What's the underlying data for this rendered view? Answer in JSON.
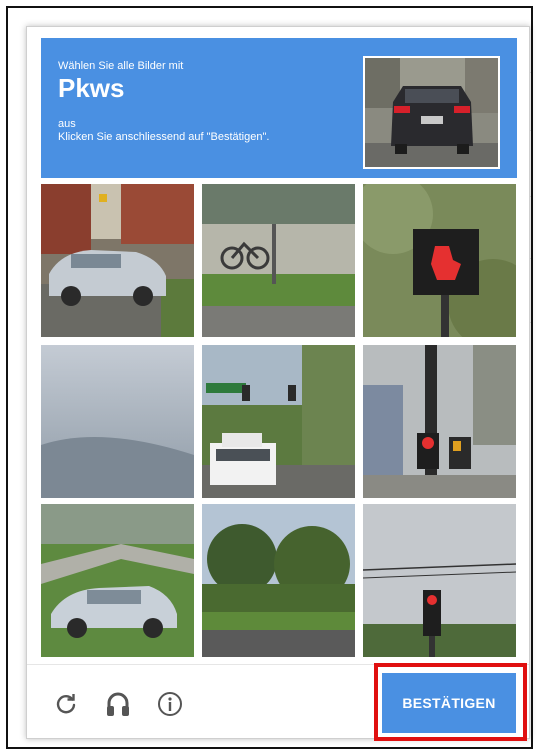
{
  "challenge": {
    "instruction_line1": "Wählen Sie alle Bilder mit",
    "target_object": "Pkws",
    "instruction_line3": "aus",
    "instruction_line4": "Klicken Sie anschliessend auf \"Bestätigen\"."
  },
  "sample_image": {
    "subject": "rear of dark car with red tail lights"
  },
  "tiles": [
    {
      "subject": "silver sedan parked on street",
      "selected": false
    },
    {
      "subject": "bicycle next to fence and grass",
      "selected": false
    },
    {
      "subject": "pedestrian signal red hand",
      "selected": false
    },
    {
      "subject": "cloudy sky",
      "selected": false
    },
    {
      "subject": "white pickup truck at intersection",
      "selected": false
    },
    {
      "subject": "traffic light pole",
      "selected": false
    },
    {
      "subject": "silver sedan on driveway",
      "selected": false
    },
    {
      "subject": "trees and road",
      "selected": false
    },
    {
      "subject": "traffic light with red signal",
      "selected": false
    }
  ],
  "footer": {
    "reload_icon": "reload-icon",
    "audio_icon": "headphones-icon",
    "info_icon": "info-icon",
    "verify_label": "BESTÄTIGEN"
  },
  "colors": {
    "accent": "#4a90e2",
    "highlight": "#e01010",
    "icon": "#555555"
  }
}
